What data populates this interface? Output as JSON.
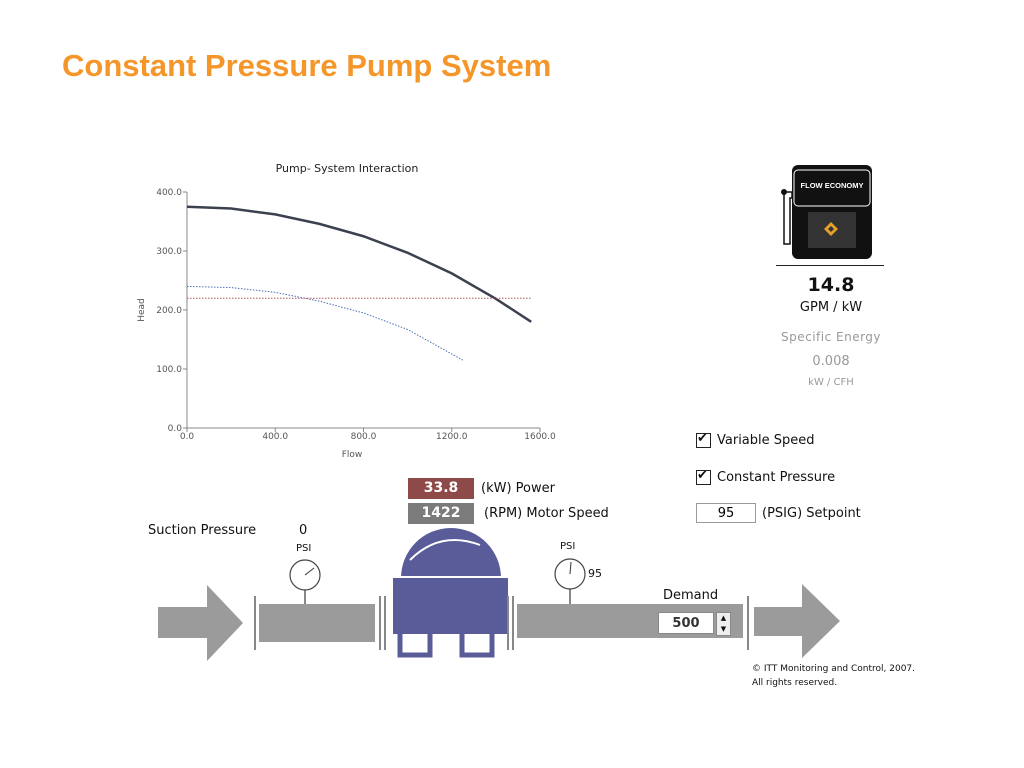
{
  "slide": {
    "title": "Constant Pressure Pump System"
  },
  "chart_data": {
    "type": "line",
    "title": "Pump- System Interaction",
    "xlabel": "Flow",
    "ylabel": "Head",
    "xlim": [
      0,
      1600
    ],
    "ylim": [
      0,
      400
    ],
    "xticks": [
      "0.0",
      "400.0",
      "800.0",
      "1200.0",
      "1600.0"
    ],
    "yticks": [
      "0.0",
      "100.0",
      "200.0",
      "300.0",
      "400.0"
    ],
    "grid": false,
    "series": [
      {
        "style": "solid-dark",
        "x": [
          0,
          200,
          400,
          600,
          800,
          1000,
          1200,
          1400,
          1560
        ],
        "y": [
          375,
          372,
          362,
          346,
          325,
          297,
          262,
          219,
          180
        ]
      },
      {
        "style": "dotted-blue",
        "x": [
          0,
          200,
          400,
          600,
          800,
          1000,
          1250
        ],
        "y": [
          240,
          238,
          230,
          215,
          195,
          167,
          115
        ]
      },
      {
        "style": "dotted-red",
        "x": [
          0,
          1560
        ],
        "y": [
          220,
          220
        ]
      }
    ]
  },
  "flow_economy": {
    "badge": "FLOW ECONOMY",
    "value": "14.8",
    "unit": "GPM / kW",
    "specific_energy_label": "Specific Energy",
    "specific_energy_value": "0.008",
    "specific_energy_unit": "kW / CFH"
  },
  "controls": {
    "variable_speed": {
      "label": "Variable Speed",
      "checked": true
    },
    "constant_pressure": {
      "label": "Constant Pressure",
      "checked": true
    },
    "setpoint": {
      "value": "95",
      "label": "(PSIG) Setpoint"
    }
  },
  "readouts": {
    "power_value": "33.8",
    "power_label": "(kW) Power",
    "speed_value": "1422",
    "speed_label": "(RPM) Motor Speed"
  },
  "suction": {
    "label": "Suction Pressure",
    "value": "0",
    "unit": "PSI"
  },
  "discharge": {
    "unit": "PSI",
    "value": "95"
  },
  "demand": {
    "label": "Demand",
    "value": "500"
  },
  "colors": {
    "title": "#f5962a",
    "power": "#8e4949",
    "speed": "#7b7b7b",
    "pump": "#5a5c9a",
    "pipe": "#9b9b9b"
  },
  "copyright": {
    "line1": "© ITT Monitoring and Control, 2007.",
    "line2": "All rights reserved."
  }
}
